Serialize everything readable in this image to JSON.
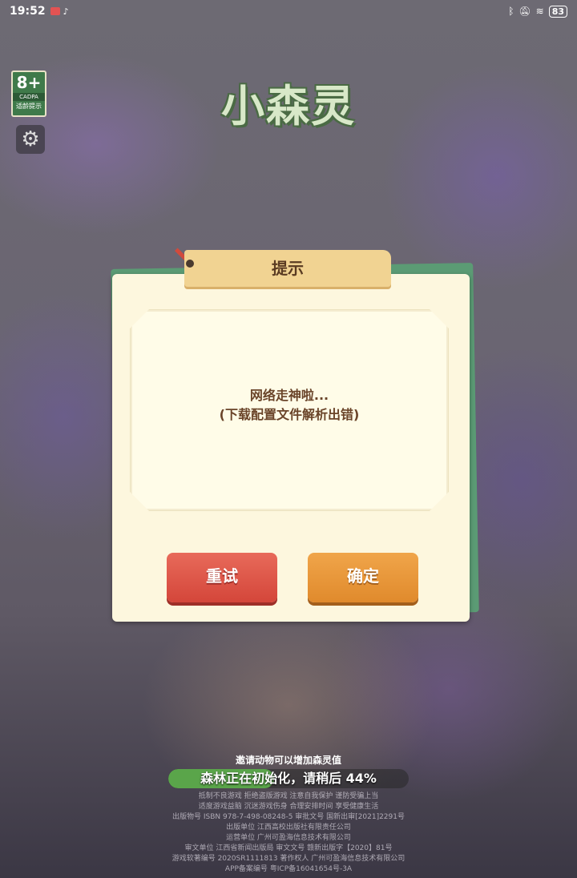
{
  "status_bar": {
    "time": "19:52",
    "app_icons": [
      "red-app-icon",
      "tiktok-icon"
    ],
    "battery": "83"
  },
  "rating": {
    "age": "8+",
    "org": "CADPA",
    "tip": "适龄提示"
  },
  "logo_text": "小森灵",
  "dialog": {
    "title": "提示",
    "message_line1": "网络走神啦...",
    "message_line2": "(下载配置文件解析出错)",
    "retry_label": "重试",
    "ok_label": "确定"
  },
  "loading": {
    "invite": "邀请动物可以增加森灵值",
    "status": "森林正在初始化，请稍后 44%",
    "progress": 0.44
  },
  "legal_lines": [
    "抵制不良游戏 拒绝盗版游戏 注意自我保护 谨防受骗上当",
    "适度游戏益脑 沉迷游戏伤身 合理安排时间 享受健康生活",
    "出版物号 ISBN 978-7-498-08248-5 审批文号 国新出审[2021]2291号",
    "出版单位 江西高校出版社有限责任公司",
    "运营单位 广州可盈海信息技术有限公司",
    "审文单位 江西省新闻出版局 审文文号 赣新出版字【2020】81号",
    "游戏软著编号 2020SR1111813 著作权人 广州可盈海信息技术有限公司",
    "APP备案编号 粤ICP备16041654号-3A"
  ]
}
